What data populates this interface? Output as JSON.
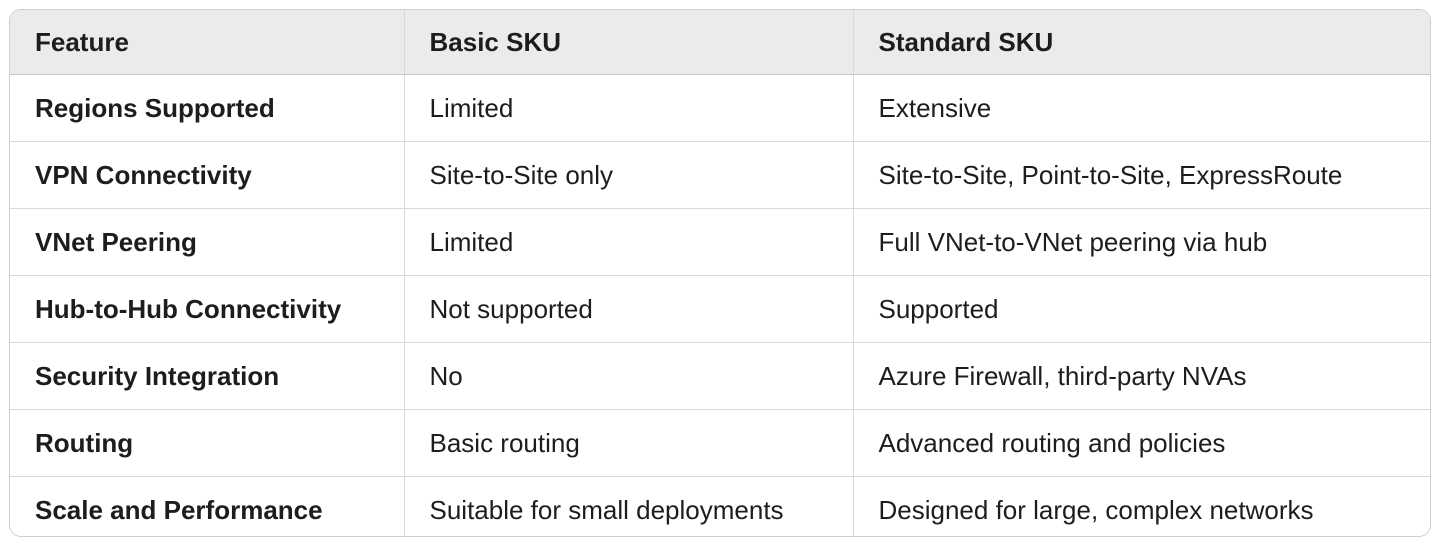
{
  "table": {
    "headers": [
      "Feature",
      "Basic SKU",
      "Standard SKU"
    ],
    "rows": [
      [
        "Regions Supported",
        "Limited",
        "Extensive"
      ],
      [
        "VPN Connectivity",
        "Site-to-Site only",
        "Site-to-Site, Point-to-Site, ExpressRoute"
      ],
      [
        "VNet Peering",
        "Limited",
        "Full VNet-to-VNet peering via hub"
      ],
      [
        "Hub-to-Hub Connectivity",
        "Not supported",
        "Supported"
      ],
      [
        "Security Integration",
        "No",
        "Azure Firewall, third-party NVAs"
      ],
      [
        "Routing",
        "Basic routing",
        "Advanced routing and policies"
      ],
      [
        "Scale and Performance",
        "Suitable for small deployments",
        "Designed for large, complex networks"
      ]
    ]
  }
}
